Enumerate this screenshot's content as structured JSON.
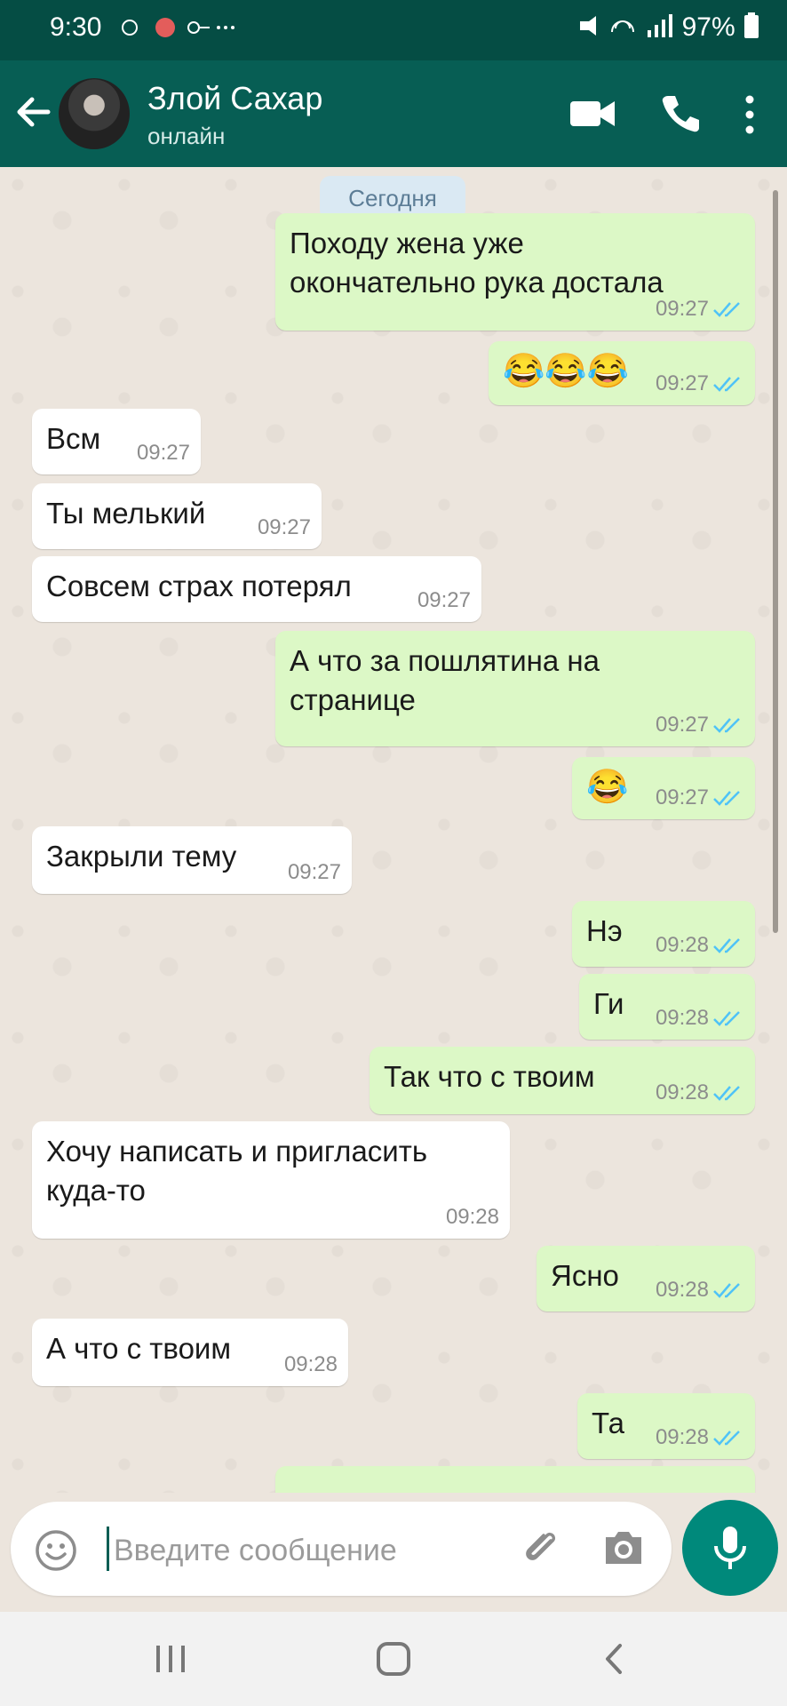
{
  "status_bar": {
    "time": "9:30",
    "battery": "97%"
  },
  "header": {
    "contact_name": "Злой Сахар",
    "contact_status": "онлайн"
  },
  "chat": {
    "date_label": "Сегодня",
    "messages": [
      {
        "dir": "out",
        "text": "Походу жена уже\nокончательно рука достала",
        "time": "09:27"
      },
      {
        "dir": "out",
        "text": "😂😂😂",
        "time": "09:27"
      },
      {
        "dir": "in",
        "text": "Всм",
        "time": "09:27"
      },
      {
        "dir": "in",
        "text": "Ты мелький",
        "time": "09:27"
      },
      {
        "dir": "in",
        "text": "Совсем страх потерял",
        "time": "09:27"
      },
      {
        "dir": "out",
        "text": "А что за пошлятина на\nстранице",
        "time": "09:27"
      },
      {
        "dir": "out",
        "text": "😂",
        "time": "09:27"
      },
      {
        "dir": "in",
        "text": "Закрыли тему",
        "time": "09:27"
      },
      {
        "dir": "out",
        "text": "Нэ",
        "time": "09:28"
      },
      {
        "dir": "out",
        "text": "Ги",
        "time": "09:28"
      },
      {
        "dir": "out",
        "text": "Так что с твоим",
        "time": "09:28"
      },
      {
        "dir": "in",
        "text": "Хочу написать и пригласить\nкуда-то",
        "time": "09:28"
      },
      {
        "dir": "out",
        "text": "Ясно",
        "time": "09:28"
      },
      {
        "dir": "in",
        "text": "А что с твоим",
        "time": "09:28"
      },
      {
        "dir": "out",
        "text": "Та",
        "time": "09:28"
      }
    ]
  },
  "composer": {
    "placeholder": "Введите сообщение"
  },
  "colors": {
    "header": "#075e54",
    "status_bar": "#054d44",
    "outgoing_bubble": "#dcf8c6",
    "incoming_bubble": "#ffffff",
    "ticks": "#4fc3f7",
    "mic_button": "#00897b"
  },
  "icons": [
    "back-arrow-icon",
    "video-call-icon",
    "voice-call-icon",
    "more-options-icon",
    "emoji-icon",
    "attach-icon",
    "camera-icon",
    "mic-icon",
    "double-check-icon"
  ]
}
